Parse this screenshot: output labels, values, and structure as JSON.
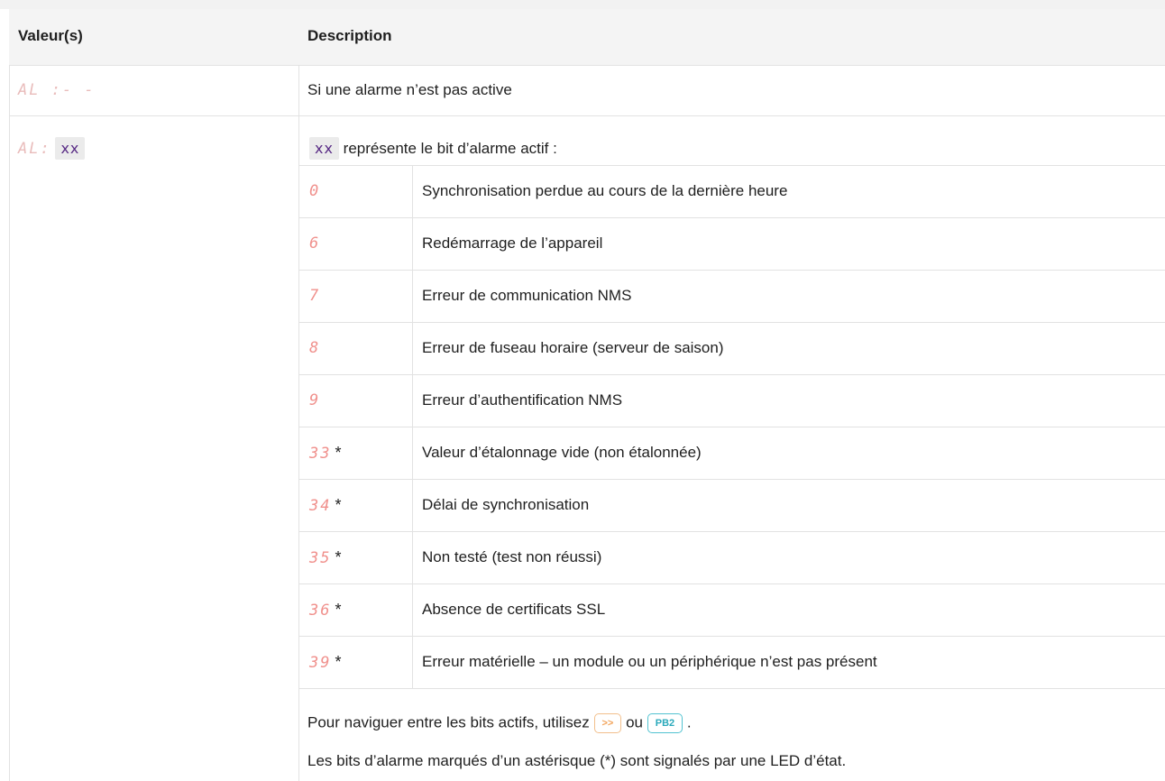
{
  "header": {
    "col_value": "Valeur(s)",
    "col_desc": "Description"
  },
  "row_inactive": {
    "code": "AL :- -",
    "desc": "Si une alarme n’est pas active"
  },
  "row_active": {
    "code_prefix": "AL:",
    "code_var": "xx",
    "intro_var": "xx",
    "intro_text": "représente le bit d’alarme actif :",
    "bits": [
      {
        "code": "0",
        "star": "",
        "desc": "Synchronisation perdue au cours de la dernière heure"
      },
      {
        "code": "6",
        "star": "",
        "desc": "Redémarrage de l’appareil"
      },
      {
        "code": "7",
        "star": "",
        "desc": "Erreur de communication NMS"
      },
      {
        "code": "8",
        "star": "",
        "desc": "Erreur de fuseau horaire (serveur de saison)"
      },
      {
        "code": "9",
        "star": "",
        "desc": "Erreur d’authentification NMS"
      },
      {
        "code": "33",
        "star": "*",
        "desc": "Valeur d’étalonnage vide (non étalonnée)"
      },
      {
        "code": "34",
        "star": "*",
        "desc": "Délai de synchronisation"
      },
      {
        "code": "35",
        "star": "*",
        "desc": "Non testé (test non réussi)"
      },
      {
        "code": "36",
        "star": "*",
        "desc": "Absence de certificats SSL"
      },
      {
        "code": "39",
        "star": "*",
        "desc": "Erreur matérielle – un module ou un périphérique n’est pas présent"
      }
    ],
    "nav_text_before": "Pour naviguer entre les bits actifs, utilisez",
    "nav_button_1": ">>",
    "nav_or": "ou",
    "nav_button_2": "PB2",
    "nav_text_after": ".",
    "footnote": "Les bits d’alarme marqués d’un astérisque (*) sont signalés par une LED d’état."
  }
}
